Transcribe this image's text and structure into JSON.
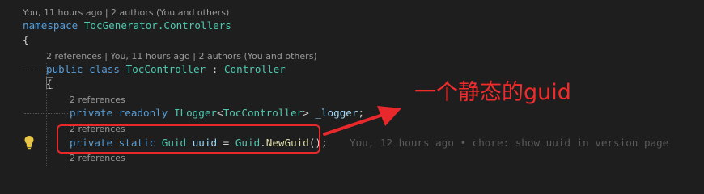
{
  "lens": {
    "namespace": "You, 11 hours ago | 2 authors (You and others)",
    "class": "2 references | You, 11 hours ago | 2 authors (You and others)",
    "logger": "2 references",
    "uuid": "2 references",
    "next": "2 references"
  },
  "code": {
    "namespace_kw": "namespace",
    "namespace_name": "TocGenerator.Controllers",
    "open_brace_1": "{",
    "public": "public",
    "class": "class",
    "class_name": "TocController",
    "colon": ":",
    "base": "Controller",
    "open_brace_2": "{",
    "private_1": "private",
    "readonly": "readonly",
    "ilogger": "ILogger",
    "lt": "<",
    "generic_arg": "TocController",
    "gt": ">",
    "logger_field": "_logger",
    "semicolon_1": ";",
    "private_2": "private",
    "static": "static",
    "guid_type": "Guid",
    "uuid_field": "uuid",
    "equals": "=",
    "guid_class": "Guid",
    "dot": ".",
    "newguid": "NewGuid",
    "call": "();"
  },
  "blame": "You, 12 hours ago • chore: show uuid in version page",
  "annotation": "一个静态的guid",
  "icons": {
    "lightbulb": "lightbulb-icon"
  },
  "colors": {
    "background": "#1e1e1e",
    "keyword": "#569cd6",
    "type": "#4ec9b0",
    "function": "#dcdcaa",
    "variable": "#9cdcfe",
    "annotation": "#f02b2b",
    "lightbulb": "#e8c545"
  }
}
